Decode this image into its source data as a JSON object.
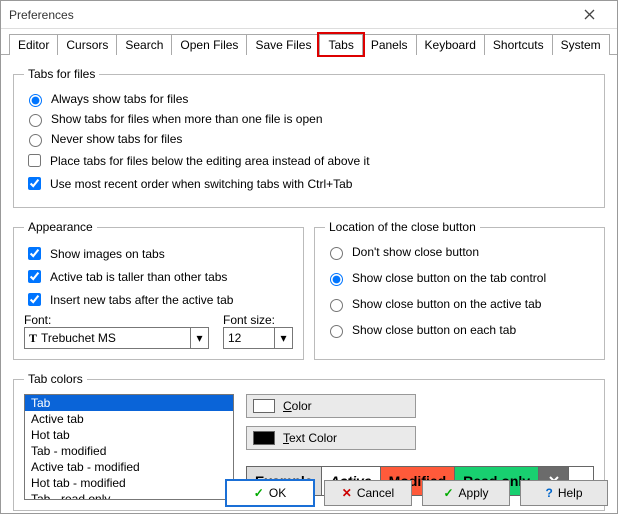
{
  "window": {
    "title": "Preferences"
  },
  "tabs": {
    "items": [
      "Editor",
      "Cursors",
      "Search",
      "Open Files",
      "Save Files",
      "Tabs",
      "Panels",
      "Keyboard",
      "Shortcuts",
      "System"
    ],
    "active": "Tabs"
  },
  "tabs_for_files": {
    "legend": "Tabs for files",
    "radios": {
      "always": "Always show tabs for files",
      "multi": "Show tabs for files when more than one file is open",
      "never": "Never show tabs for files"
    },
    "below": "Place tabs for files below the editing area instead of above it",
    "mru": "Use most recent order when switching tabs with Ctrl+Tab",
    "selected_radio": "always",
    "below_checked": false,
    "mru_checked": true
  },
  "appearance": {
    "legend": "Appearance",
    "show_images": "Show images on tabs",
    "taller": "Active tab is taller than other tabs",
    "insert_after": "Insert new tabs after the active tab",
    "font_label": "Font:",
    "font_value": "Trebuchet MS",
    "size_label": "Font size:",
    "size_value": "12"
  },
  "close_button": {
    "legend": "Location of the close button",
    "none": "Don't show close button",
    "on_control": "Show close button on the tab control",
    "on_active": "Show close button on the active tab",
    "on_each": "Show close button on each tab",
    "selected": "on_control"
  },
  "tab_colors": {
    "legend": "Tab colors",
    "items": [
      "Tab",
      "Active tab",
      "Hot tab",
      "Tab - modified",
      "Active tab - modified",
      "Hot tab - modified",
      "Tab - read only"
    ],
    "selected": "Tab",
    "color_btn": "Color",
    "textcolor_btn": "Text Color",
    "swatch1": "#ffffff",
    "swatch2": "#000000",
    "examples": {
      "example": {
        "label": "Example",
        "bg": "#dcdcdc",
        "fg": "#000"
      },
      "active": {
        "label": "Active",
        "bg": "#ffffff",
        "fg": "#000"
      },
      "modified": {
        "label": "Modified",
        "bg": "#ff5a3a",
        "fg": "#000"
      },
      "readonly": {
        "label": "Read only",
        "bg": "#18d070",
        "fg": "#000"
      },
      "close_bg": "#6b6b6b"
    }
  },
  "footer": {
    "ok": "OK",
    "cancel": "Cancel",
    "apply": "Apply",
    "help": "Help"
  }
}
